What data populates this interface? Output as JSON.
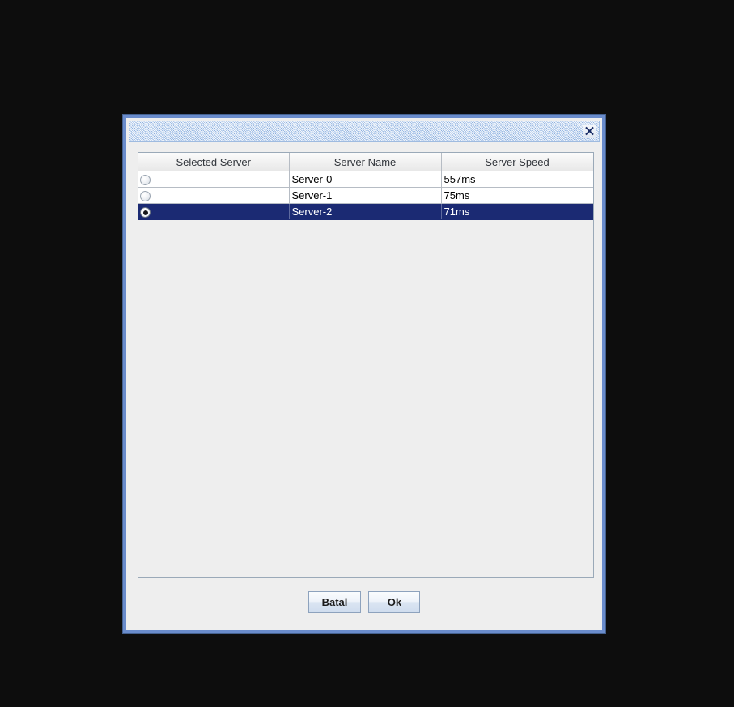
{
  "window": {
    "title": "",
    "close_icon": "close-icon",
    "close_label": "X"
  },
  "table": {
    "columns": [
      "Selected Server",
      "Server Name",
      "Server Speed"
    ],
    "rows": [
      {
        "selected": "false",
        "name": "Server-0",
        "speed": "557ms"
      },
      {
        "selected": "false",
        "name": "Server-1",
        "speed": "75ms"
      },
      {
        "selected": "true",
        "name": "Server-2",
        "speed": "71ms"
      }
    ]
  },
  "buttons": {
    "cancel_label": "Batal",
    "ok_label": "Ok"
  },
  "colors": {
    "selection_background": "#1b2a73",
    "selection_foreground": "#ffffff",
    "dialog_border": "#6a8ccc",
    "panel_background": "#eeeeee",
    "titlebar_background": "#c0d5f0",
    "desktop_background": "#0d0d0d"
  }
}
